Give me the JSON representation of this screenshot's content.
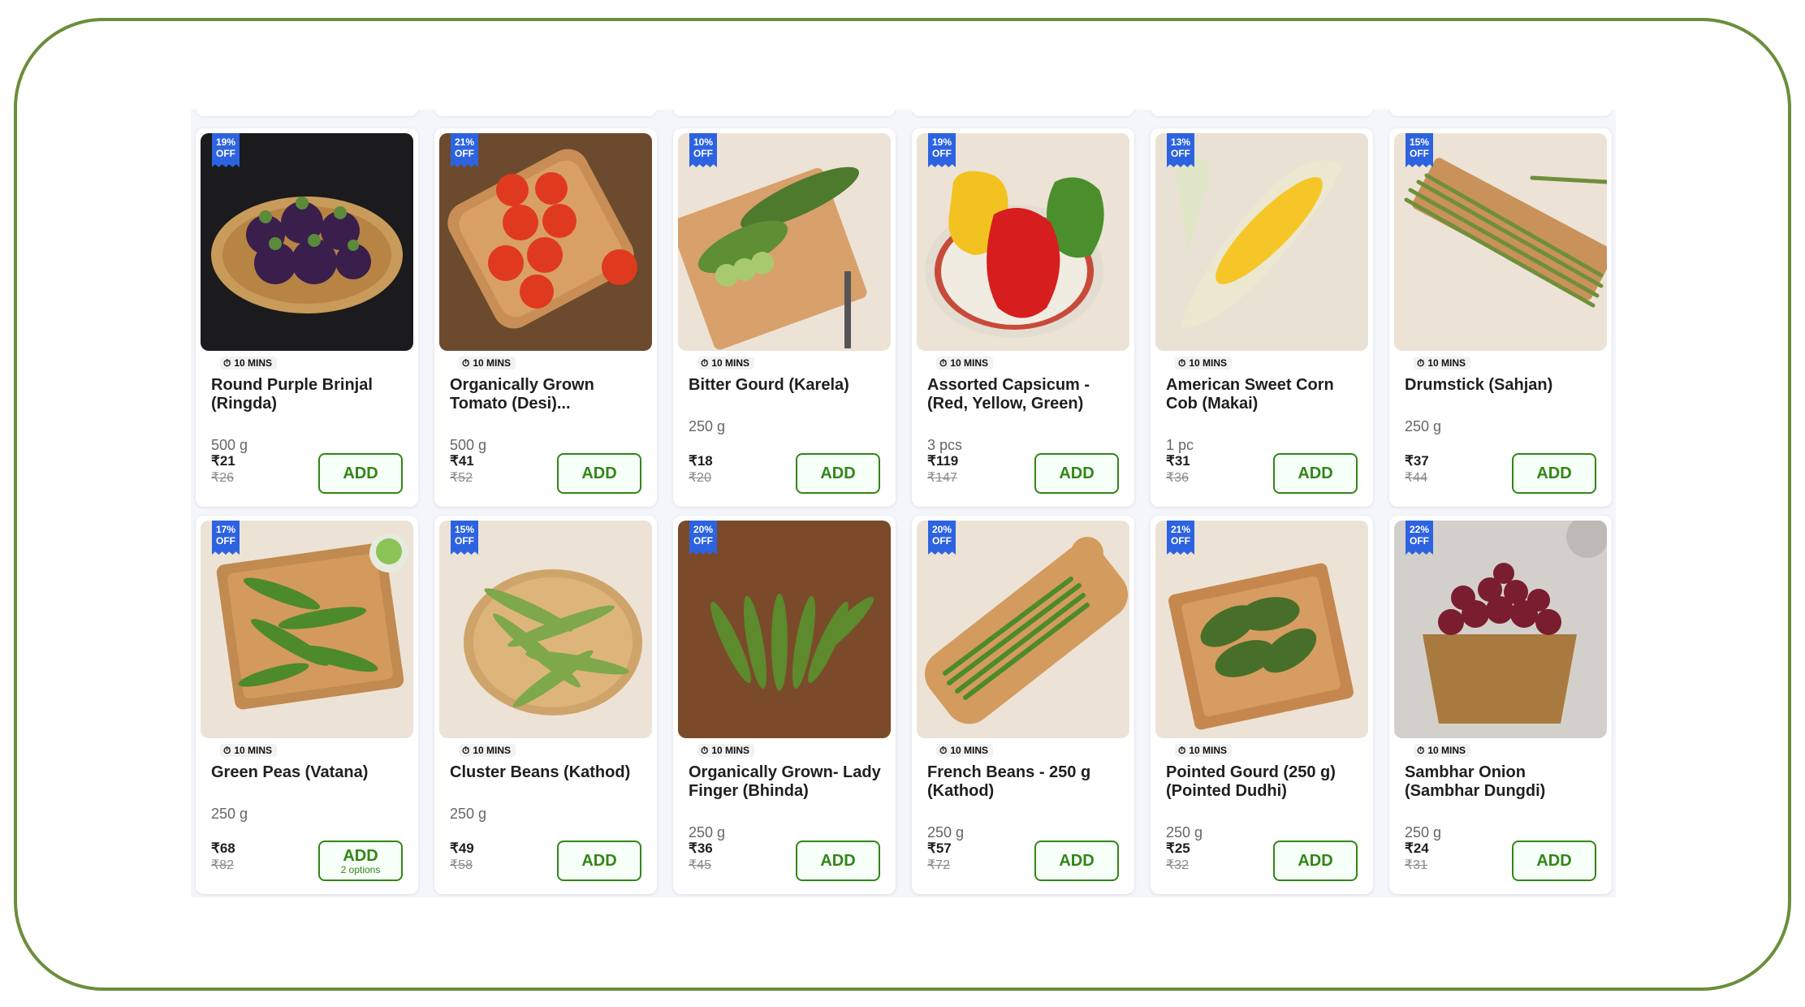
{
  "colors": {
    "frame_border": "#6b8e3a",
    "discount_badge": "#2d63e0",
    "add_button": "#318616",
    "card_bg": "#ffffff"
  },
  "products": [
    {
      "discount": "19%",
      "off": "OFF",
      "eta": "10 MINS",
      "name": "Round Purple Brinjal (Ringda)",
      "qty": "500 g",
      "price": "₹21",
      "mrp": "₹26",
      "add": "ADD",
      "options": "",
      "image": "purple-brinjal-image"
    },
    {
      "discount": "21%",
      "off": "OFF",
      "eta": "10 MINS",
      "name": "Organically Grown Tomato (Desi)...",
      "qty": "500 g",
      "price": "₹41",
      "mrp": "₹52",
      "add": "ADD",
      "options": "",
      "image": "tomato-image"
    },
    {
      "discount": "10%",
      "off": "OFF",
      "eta": "10 MINS",
      "name": "Bitter Gourd (Karela)",
      "qty": "250 g",
      "price": "₹18",
      "mrp": "₹20",
      "add": "ADD",
      "options": "",
      "image": "bitter-gourd-image"
    },
    {
      "discount": "19%",
      "off": "OFF",
      "eta": "10 MINS",
      "name": "Assorted Capsicum - (Red, Yellow, Green)",
      "qty": "3 pcs",
      "price": "₹119",
      "mrp": "₹147",
      "add": "ADD",
      "options": "",
      "image": "capsicum-image"
    },
    {
      "discount": "13%",
      "off": "OFF",
      "eta": "10 MINS",
      "name": "American Sweet Corn Cob (Makai)",
      "qty": "1 pc",
      "price": "₹31",
      "mrp": "₹36",
      "add": "ADD",
      "options": "",
      "image": "sweet-corn-image"
    },
    {
      "discount": "15%",
      "off": "OFF",
      "eta": "10 MINS",
      "name": "Drumstick (Sahjan)",
      "qty": "250 g",
      "price": "₹37",
      "mrp": "₹44",
      "add": "ADD",
      "options": "",
      "image": "drumstick-image"
    },
    {
      "discount": "17%",
      "off": "OFF",
      "eta": "10 MINS",
      "name": "Green Peas (Vatana)",
      "qty": "250 g",
      "price": "₹68",
      "mrp": "₹82",
      "add": "ADD",
      "options": "2 options",
      "image": "green-peas-image"
    },
    {
      "discount": "15%",
      "off": "OFF",
      "eta": "10 MINS",
      "name": "Cluster Beans (Kathod)",
      "qty": "250 g",
      "price": "₹49",
      "mrp": "₹58",
      "add": "ADD",
      "options": "",
      "image": "cluster-beans-image"
    },
    {
      "discount": "20%",
      "off": "OFF",
      "eta": "10 MINS",
      "name": "Organically Grown- Lady Finger (Bhinda)",
      "qty": "250 g",
      "price": "₹36",
      "mrp": "₹45",
      "add": "ADD",
      "options": "",
      "image": "lady-finger-image"
    },
    {
      "discount": "20%",
      "off": "OFF",
      "eta": "10 MINS",
      "name": "French Beans - 250 g (Kathod)",
      "qty": "250 g",
      "price": "₹57",
      "mrp": "₹72",
      "add": "ADD",
      "options": "",
      "image": "french-beans-image"
    },
    {
      "discount": "21%",
      "off": "OFF",
      "eta": "10 MINS",
      "name": "Pointed Gourd (250 g) (Pointed Dudhi)",
      "qty": "250 g",
      "price": "₹25",
      "mrp": "₹32",
      "add": "ADD",
      "options": "",
      "image": "pointed-gourd-image"
    },
    {
      "discount": "22%",
      "off": "OFF",
      "eta": "10 MINS",
      "name": "Sambhar Onion (Sambhar Dungdi)",
      "qty": "250 g",
      "price": "₹24",
      "mrp": "₹31",
      "add": "ADD",
      "options": "",
      "image": "sambhar-onion-image"
    }
  ]
}
